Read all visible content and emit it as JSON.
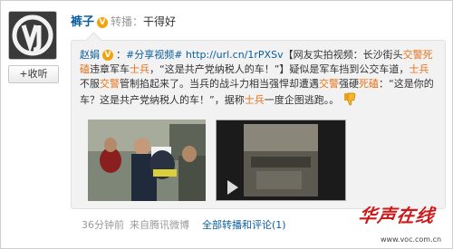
{
  "follow_button": "+收听",
  "header": {
    "username": "裤子",
    "verified_badge": "V",
    "repost_label": "转播：",
    "repost_text": "干得好"
  },
  "original_post": {
    "author": "赵娟",
    "text_segments": [
      {
        "text": "：",
        "style": "normal"
      },
      {
        "text": "#分享视频# http://url.cn/1rPXSv",
        "style": "link"
      },
      {
        "text": "【网友实拍视频：长沙街头",
        "style": "normal"
      },
      {
        "text": "交警死磕",
        "style": "hl"
      },
      {
        "text": "违章军车",
        "style": "normal"
      },
      {
        "text": "士兵",
        "style": "hl"
      },
      {
        "text": "，“这是共产党纳税人的车！”】疑似是军车挡到公交车道，",
        "style": "normal"
      },
      {
        "text": "士兵",
        "style": "hl"
      },
      {
        "text": "不服",
        "style": "normal"
      },
      {
        "text": "交警",
        "style": "hl"
      },
      {
        "text": "管制掐起来了。当兵的战斗力相当强悍却遭遇",
        "style": "normal"
      },
      {
        "text": "交警",
        "style": "hl"
      },
      {
        "text": "强硬",
        "style": "normal"
      },
      {
        "text": "死磕",
        "style": "hl"
      },
      {
        "text": "：“这是你的车？这是共产党纳税人的车！”，据称",
        "style": "normal"
      },
      {
        "text": "士兵",
        "style": "hl"
      },
      {
        "text": "一度企图逃跑。。",
        "style": "normal"
      }
    ],
    "images": [
      {
        "name": "street-confrontation-photo"
      },
      {
        "name": "video-thumbnail"
      }
    ]
  },
  "footer": {
    "time": "36分钟前",
    "source": "来自腾讯微博",
    "action": "全部转播和评论(1)"
  },
  "watermark": {
    "logo": "华声在线",
    "url": "www.voc.com.cn"
  },
  "colors": {
    "link": "#0a5ea0",
    "highlight": "#e8731a",
    "badge": "#f3a20a",
    "watermark": "#cc1a1a"
  }
}
